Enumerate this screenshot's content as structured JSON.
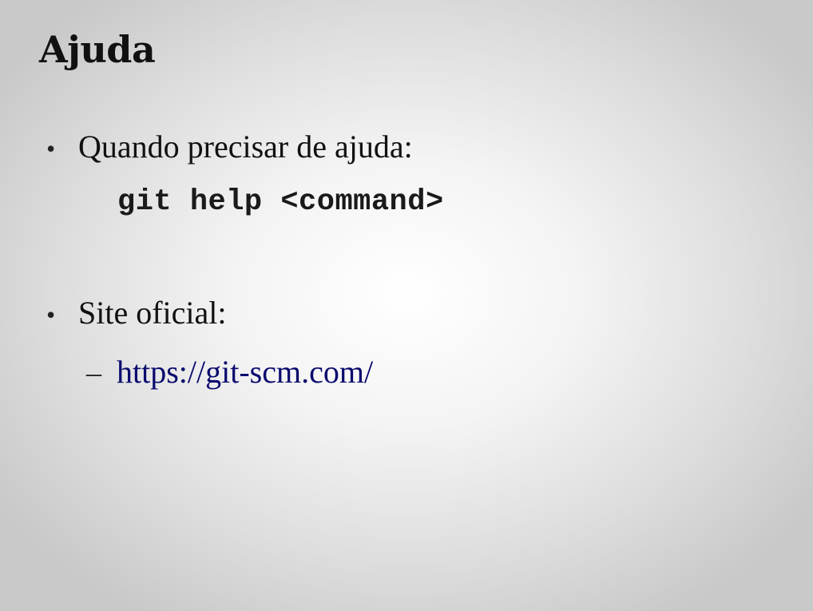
{
  "slide": {
    "title": "Ajuda",
    "bullets": [
      {
        "marker": "•",
        "text": "Quando precisar de ajuda:",
        "code": "git help <command>"
      },
      {
        "marker": "•",
        "text": "Site oficial:",
        "sub_items": [
          {
            "marker": "–",
            "text": "https://git-scm.com/",
            "link_color": "#0a0a6e"
          }
        ]
      }
    ]
  }
}
